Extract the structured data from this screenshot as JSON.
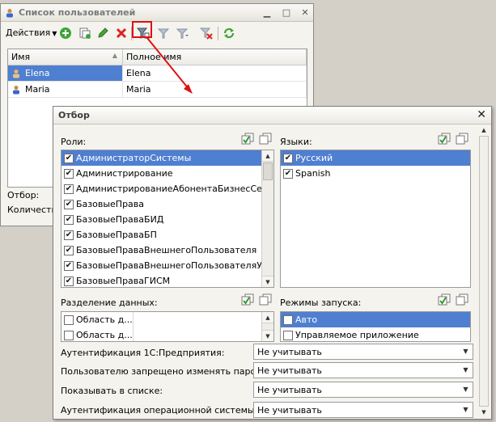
{
  "users_window": {
    "title": "Список пользователей",
    "actions_label": "Действия",
    "columns": [
      "Имя",
      "Полное имя"
    ],
    "rows": [
      {
        "name": "Elena",
        "full_name": "Elena",
        "selected": true
      },
      {
        "name": "Maria",
        "full_name": "Maria",
        "selected": false
      }
    ],
    "filter_label": "Отбор:",
    "count_label": "Количество"
  },
  "filter_dialog": {
    "title": "Отбор",
    "roles": {
      "label": "Роли:",
      "items": [
        {
          "label": "АдминистраторСистемы",
          "checked": true,
          "selected": true
        },
        {
          "label": "Администрирование",
          "checked": true
        },
        {
          "label": "АдминистрированиеАбонентаБизнесСеть",
          "checked": true
        },
        {
          "label": "БазовыеПрава",
          "checked": true
        },
        {
          "label": "БазовыеПраваБИД",
          "checked": true
        },
        {
          "label": "БазовыеПраваБП",
          "checked": true
        },
        {
          "label": "БазовыеПраваВнешнегоПользователя",
          "checked": true
        },
        {
          "label": "БазовыеПраваВнешнегоПользователяУТ",
          "checked": true
        },
        {
          "label": "БазовыеПраваГИСМ",
          "checked": true
        }
      ]
    },
    "languages": {
      "label": "Языки:",
      "items": [
        {
          "label": "Русский",
          "checked": true,
          "selected": true
        },
        {
          "label": "Spanish",
          "checked": true
        }
      ]
    },
    "data_separation": {
      "label": "Разделение данных:",
      "items": [
        {
          "label": "Область д...",
          "checked": false
        },
        {
          "label": "Область д...",
          "checked": false
        }
      ]
    },
    "launch_modes": {
      "label": "Режимы запуска:",
      "items": [
        {
          "label": "Авто",
          "checked": false,
          "selected": true
        },
        {
          "label": "Управляемое приложение",
          "checked": false
        }
      ]
    },
    "properties": [
      {
        "label": "Аутентификация 1С:Предприятия:",
        "value": "Не учитывать"
      },
      {
        "label": "Пользователю запрещено изменять пароль:",
        "value": "Не учитывать"
      },
      {
        "label": "Показывать в списке:",
        "value": "Не учитывать"
      },
      {
        "label": "Аутентификация операционной системы:",
        "value": "Не учитывать"
      }
    ]
  },
  "colors": {
    "selection": "#4f7fd0",
    "highlight_box": "#e01010",
    "window_bg": "#f4f3ee"
  }
}
